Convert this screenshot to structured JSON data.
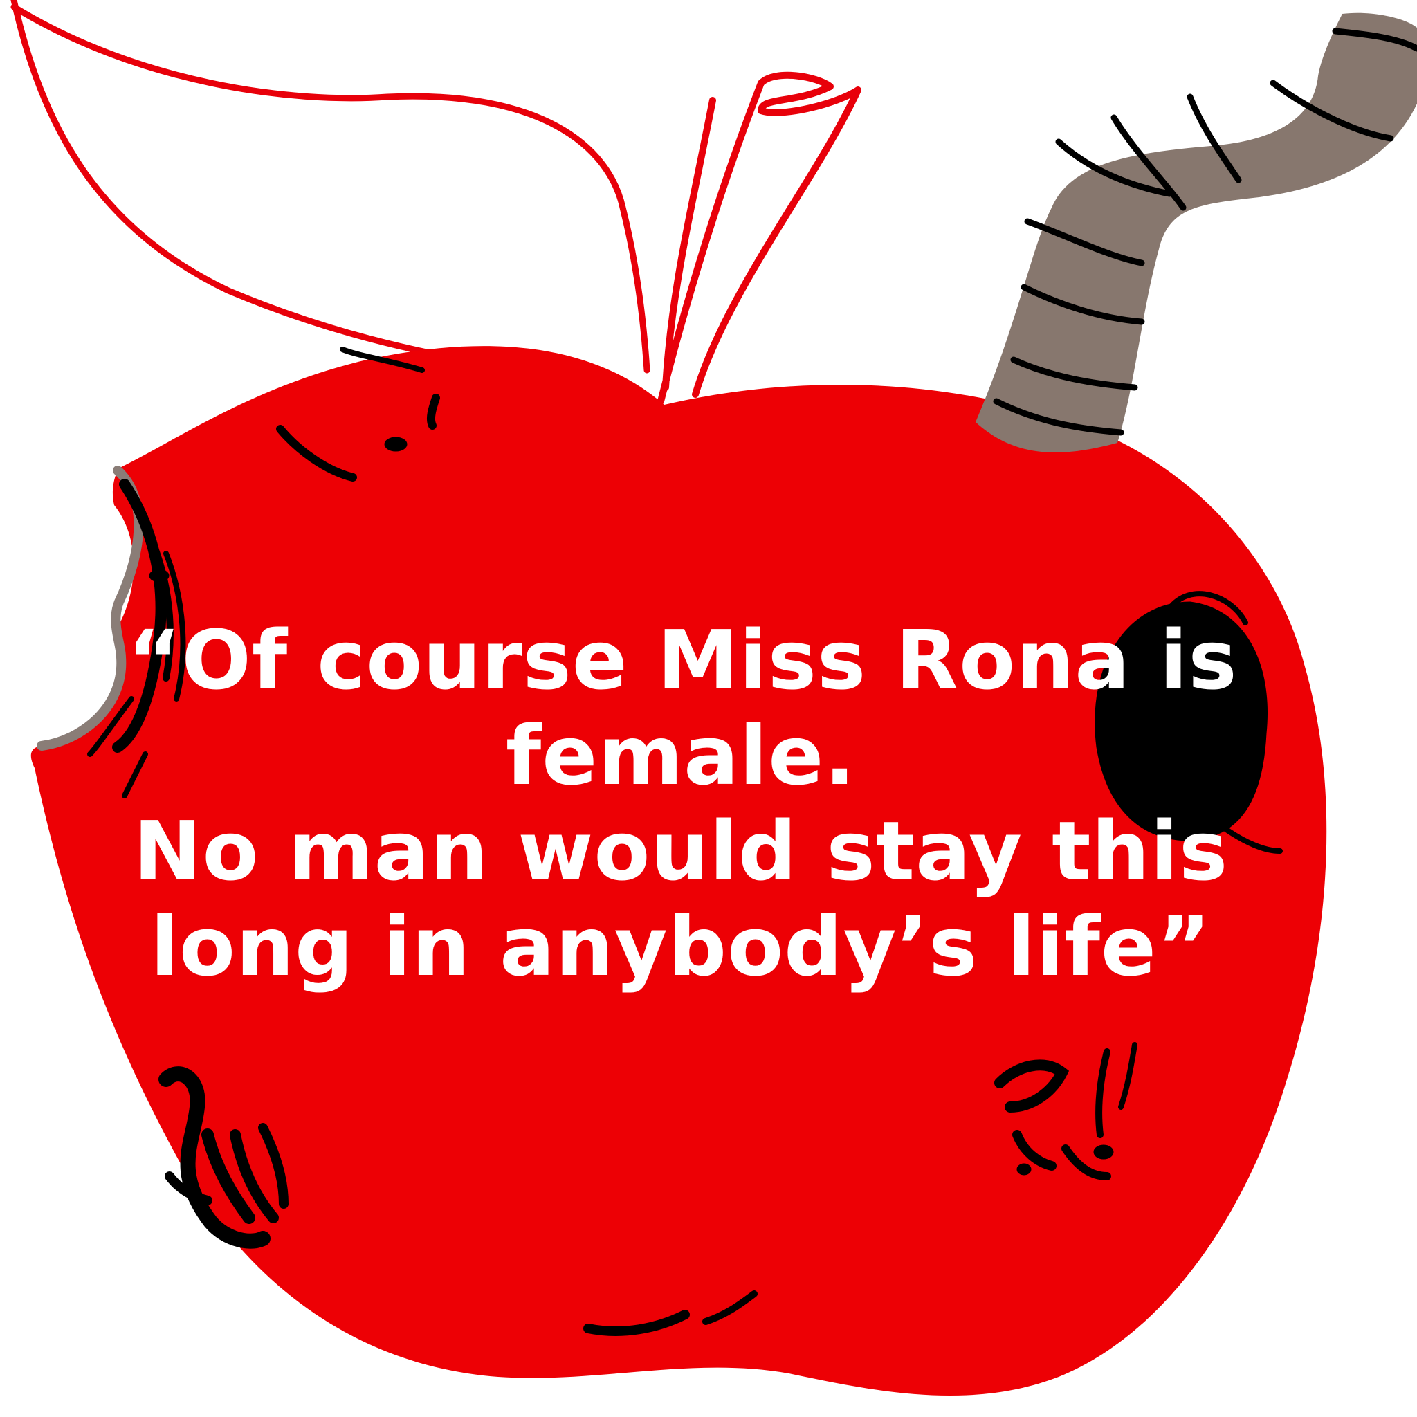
{
  "colors": {
    "apple_red": "#ed0005",
    "outline_red": "#e8000a",
    "worm_gray": "#87776e",
    "bite_gray": "#8a7d77",
    "spot_black": "#000000",
    "text_white": "#ffffff"
  },
  "quote": {
    "line1": "“Of course Miss Rona is",
    "line2": "female.",
    "line3": "No man would stay this",
    "line4": "long in anybody’s life”"
  }
}
